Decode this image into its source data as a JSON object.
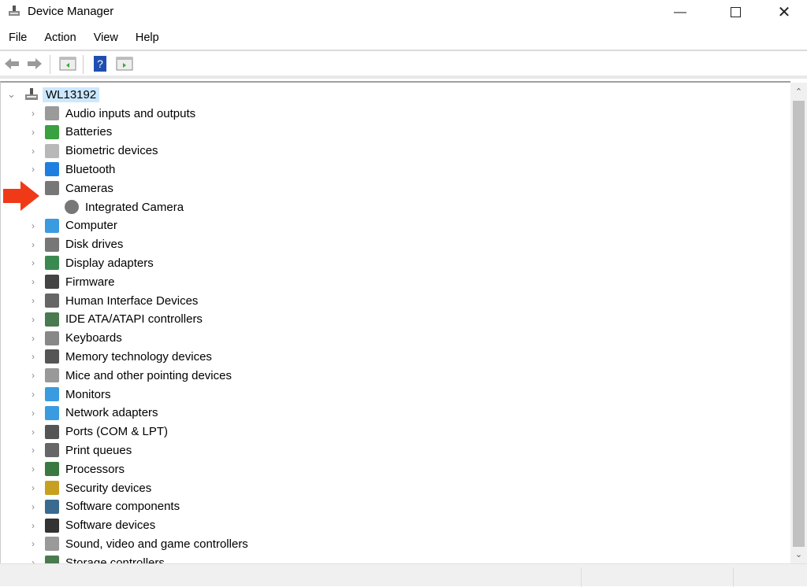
{
  "window": {
    "title": "Device Manager",
    "app_icon": "device-manager-icon",
    "controls": [
      "minimize",
      "maximize",
      "close"
    ]
  },
  "menu": [
    {
      "label": "File"
    },
    {
      "label": "Action"
    },
    {
      "label": "View"
    },
    {
      "label": "Help"
    }
  ],
  "toolbar": {
    "buttons": [
      "back-icon",
      "forward-icon",
      "properties-pane-icon",
      "help-icon",
      "action-pane-icon"
    ]
  },
  "tree": {
    "root": {
      "label": "WL13192",
      "expanded": true,
      "selected": true,
      "icon": "computer-node-icon"
    },
    "items": [
      {
        "label": "Audio inputs and outputs",
        "icon": "speaker-icon",
        "color": "#9a9a9a"
      },
      {
        "label": "Batteries",
        "icon": "battery-icon",
        "color": "#3aa040"
      },
      {
        "label": "Biometric devices",
        "icon": "fingerprint-icon",
        "color": "#b8b8b8"
      },
      {
        "label": "Bluetooth",
        "icon": "bluetooth-icon",
        "color": "#1e7fe0"
      },
      {
        "label": "Cameras",
        "icon": "camera-icon",
        "color": "#777777",
        "expanded": true,
        "children": [
          {
            "label": "Integrated Camera",
            "icon": "camera-icon"
          }
        ]
      },
      {
        "label": "Computer",
        "icon": "monitor-icon",
        "color": "#3a9be0"
      },
      {
        "label": "Disk drives",
        "icon": "disk-drive-icon",
        "color": "#777777"
      },
      {
        "label": "Display adapters",
        "icon": "display-adapter-icon",
        "color": "#3a8a50"
      },
      {
        "label": "Firmware",
        "icon": "firmware-icon",
        "color": "#444444"
      },
      {
        "label": "Human Interface Devices",
        "icon": "hid-icon",
        "color": "#666666"
      },
      {
        "label": "IDE ATA/ATAPI controllers",
        "icon": "ide-controller-icon",
        "color": "#4a7a50"
      },
      {
        "label": "Keyboards",
        "icon": "keyboard-icon",
        "color": "#888888"
      },
      {
        "label": "Memory technology devices",
        "icon": "memory-icon",
        "color": "#555555"
      },
      {
        "label": "Mice and other pointing devices",
        "icon": "mouse-icon",
        "color": "#999999"
      },
      {
        "label": "Monitors",
        "icon": "monitor-icon",
        "color": "#3a9be0"
      },
      {
        "label": "Network adapters",
        "icon": "network-icon",
        "color": "#3a9be0"
      },
      {
        "label": "Ports (COM & LPT)",
        "icon": "port-icon",
        "color": "#555555"
      },
      {
        "label": "Print queues",
        "icon": "printer-icon",
        "color": "#666666"
      },
      {
        "label": "Processors",
        "icon": "processor-icon",
        "color": "#3a7a40"
      },
      {
        "label": "Security devices",
        "icon": "security-key-icon",
        "color": "#c8a020"
      },
      {
        "label": "Software components",
        "icon": "software-component-icon",
        "color": "#3a6a90"
      },
      {
        "label": "Software devices",
        "icon": "software-device-icon",
        "color": "#333333"
      },
      {
        "label": "Sound, video and game controllers",
        "icon": "speaker-icon",
        "color": "#9a9a9a"
      },
      {
        "label": "Storage controllers",
        "icon": "storage-controller-icon",
        "color": "#4a7a50"
      }
    ]
  },
  "annotation": {
    "icon": "red-arrow-icon",
    "color": "#f03a17"
  }
}
